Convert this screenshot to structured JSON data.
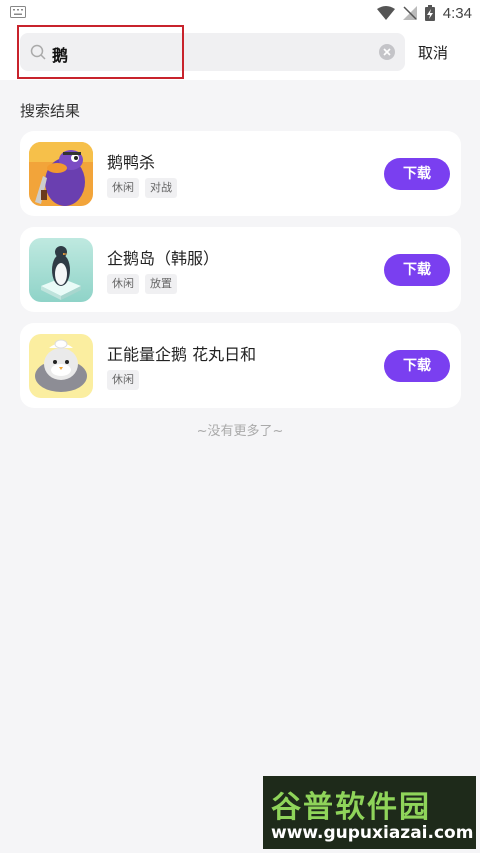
{
  "status_bar": {
    "time": "4:34",
    "icons": [
      "keyboard-icon",
      "wifi-icon",
      "no-signal-icon",
      "battery-charging-icon"
    ]
  },
  "search": {
    "query": "鹅",
    "cancel_label": "取消"
  },
  "results": {
    "title": "搜索结果",
    "items": [
      {
        "name": "鹅鸭杀",
        "tags": [
          "休闲",
          "对战"
        ],
        "button": "下载",
        "icon": "goose-duck-game-icon"
      },
      {
        "name": "企鹅岛（韩服）",
        "tags": [
          "休闲",
          "放置"
        ],
        "button": "下载",
        "icon": "penguin-isle-icon"
      },
      {
        "name": "正能量企鹅 花丸日和",
        "tags": [
          "休闲"
        ],
        "button": "下载",
        "icon": "positive-penguin-icon"
      }
    ],
    "end_text": "~没有更多了~"
  },
  "watermark": {
    "title": "谷普软件园",
    "url": "www.gupuxiazai.com"
  },
  "colors": {
    "accent": "#7a3ff0",
    "highlight_box": "#c8232c",
    "background": "#f5f5f7"
  }
}
